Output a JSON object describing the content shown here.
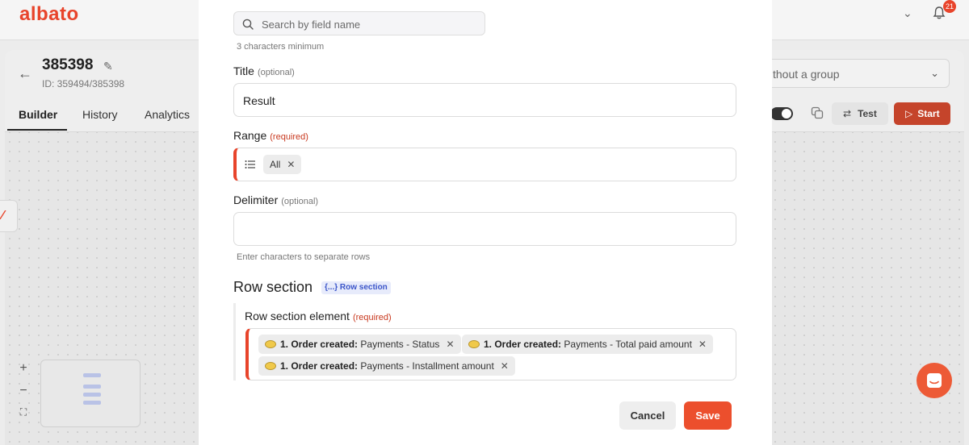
{
  "app": {
    "logo": "albato",
    "notifications_count": "21"
  },
  "bundle": {
    "title": "385398",
    "id_label": "ID: 359494/385398"
  },
  "tabs": [
    {
      "label": "Builder",
      "active": true
    },
    {
      "label": "History",
      "active": false
    },
    {
      "label": "Analytics",
      "active": false
    }
  ],
  "toolbar": {
    "group_select_value": "thout a group",
    "test_label": "Test",
    "start_label": "Start"
  },
  "modal": {
    "search": {
      "placeholder": "Search by field name",
      "hint": "3 characters minimum"
    },
    "fields": {
      "title": {
        "label": "Title",
        "tag": "(optional)",
        "value": "Result"
      },
      "range": {
        "label": "Range",
        "tag": "(required)",
        "chip": "All"
      },
      "delimiter": {
        "label": "Delimiter",
        "tag": "(optional)",
        "value": "",
        "hint": "Enter characters to separate rows"
      }
    },
    "row_section": {
      "title": "Row section",
      "badge": "{...} Row section",
      "element_label": "Row section element",
      "element_tag": "(required)",
      "chips": [
        {
          "source": "1. Order created:",
          "field": "Payments - Status"
        },
        {
          "source": "1. Order created:",
          "field": "Payments - Total paid amount"
        },
        {
          "source": "1. Order created:",
          "field": "Payments - Installment amount"
        }
      ]
    },
    "actions": {
      "cancel": "Cancel",
      "save": "Save"
    }
  },
  "colors": {
    "brand": "#e8442b",
    "save_button": "#ec4f2d",
    "start_button": "#c5442b",
    "badge_text": "#3b55c9"
  }
}
